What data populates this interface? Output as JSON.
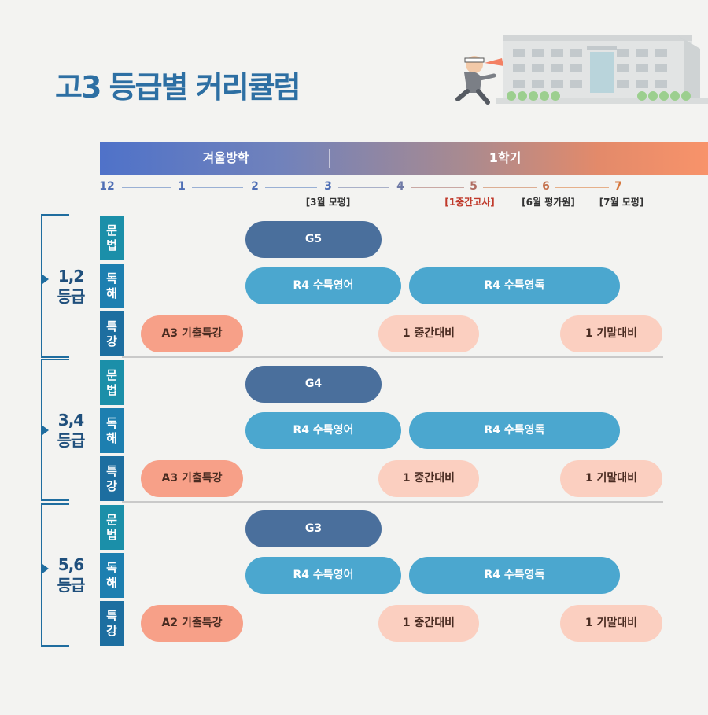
{
  "title": "고3 등급별 커리큘럼",
  "terms": [
    {
      "label": "겨울방학"
    },
    {
      "label": "1학기"
    }
  ],
  "months": [
    {
      "label": "12",
      "color": "#4f6fb5"
    },
    {
      "label": "1",
      "color": "#4f6fb5"
    },
    {
      "label": "2",
      "color": "#4f6fb5"
    },
    {
      "label": "3",
      "color": "#4f6fb5"
    },
    {
      "label": "4",
      "color": "#6f7aa6"
    },
    {
      "label": "5",
      "color": "#b06d63"
    },
    {
      "label": "6",
      "color": "#c4704c"
    },
    {
      "label": "7",
      "color": "#d6783f"
    }
  ],
  "events": [
    {
      "label": "[3월 모평]",
      "color": "#333333"
    },
    {
      "label": "[1중간고사]",
      "color": "#c0392b"
    },
    {
      "label": "[6월 평가원]",
      "color": "#333333"
    },
    {
      "label": "[7월 모평]",
      "color": "#333333"
    }
  ],
  "categories": [
    {
      "top": "문",
      "bottom": "법"
    },
    {
      "top": "독",
      "bottom": "해"
    },
    {
      "top": "특",
      "bottom": "강"
    }
  ],
  "groups": [
    {
      "label_top": "1,2",
      "label_bottom": "등급",
      "grammar": "G5",
      "reading1": "R4 수특영어",
      "reading2": "R4 수특영독",
      "special1": "A3 기출특강",
      "special2": "1 중간대비",
      "special3": "1 기말대비"
    },
    {
      "label_top": "3,4",
      "label_bottom": "등급",
      "grammar": "G4",
      "reading1": "R4 수특영어",
      "reading2": "R4 수특영독",
      "special1": "A3 기출특강",
      "special2": "1 중간대비",
      "special3": "1 기말대비"
    },
    {
      "label_top": "5,6",
      "label_bottom": "등급",
      "grammar": "G3",
      "reading1": "R4 수특영어",
      "reading2": "R4 수특영독",
      "special1": "A2 기출특강",
      "special2": "1 중간대비",
      "special3": "1 기말대비"
    }
  ]
}
